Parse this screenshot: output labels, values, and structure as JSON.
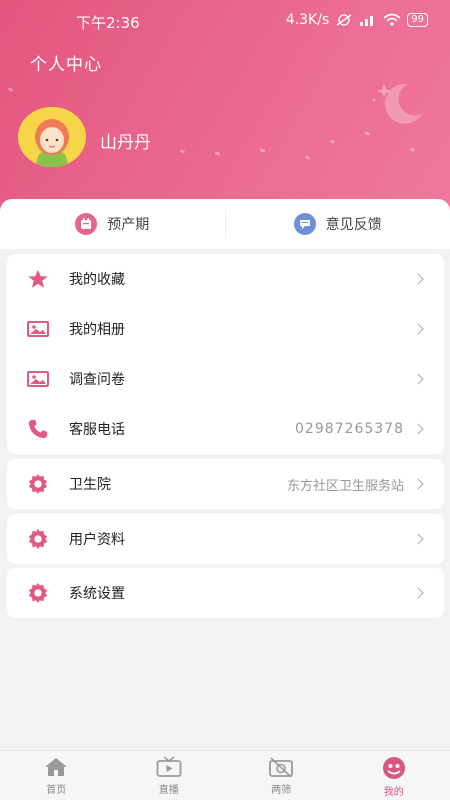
{
  "status_bar": {
    "time": "下午2:36",
    "speed": "4.3K/s",
    "battery": "99"
  },
  "header": {
    "title": "个人中心",
    "username": "山丹丹"
  },
  "quick_actions": [
    {
      "label": "预产期",
      "icon": "calendar-icon",
      "color": "#e6658a"
    },
    {
      "label": "意见反馈",
      "icon": "chat-bubble-icon",
      "color": "#6f8fd8"
    }
  ],
  "menu_group_1": [
    {
      "label": "我的收藏",
      "icon": "star-icon",
      "value": ""
    },
    {
      "label": "我的相册",
      "icon": "image-icon",
      "value": ""
    },
    {
      "label": "调查问卷",
      "icon": "image-icon",
      "value": ""
    },
    {
      "label": "客服电话",
      "icon": "phone-icon",
      "value": "02987265378"
    }
  ],
  "menu_hospital": {
    "label": "卫生院",
    "icon": "gear-icon",
    "value": "东方社区卫生服务站"
  },
  "menu_profile": {
    "label": "用户资料",
    "icon": "gear-icon"
  },
  "menu_settings": {
    "label": "系统设置",
    "icon": "gear-icon"
  },
  "tabbar": [
    {
      "label": "首页",
      "icon": "home-icon",
      "active": false
    },
    {
      "label": "直播",
      "icon": "tv-icon",
      "active": false
    },
    {
      "label": "两筛",
      "icon": "camera-off-icon",
      "active": false
    },
    {
      "label": "我的",
      "icon": "profile-icon",
      "active": true
    }
  ],
  "colors": {
    "accent": "#e4557e",
    "icon_pink": "#e05a82",
    "tab_active": "#d9577d"
  }
}
